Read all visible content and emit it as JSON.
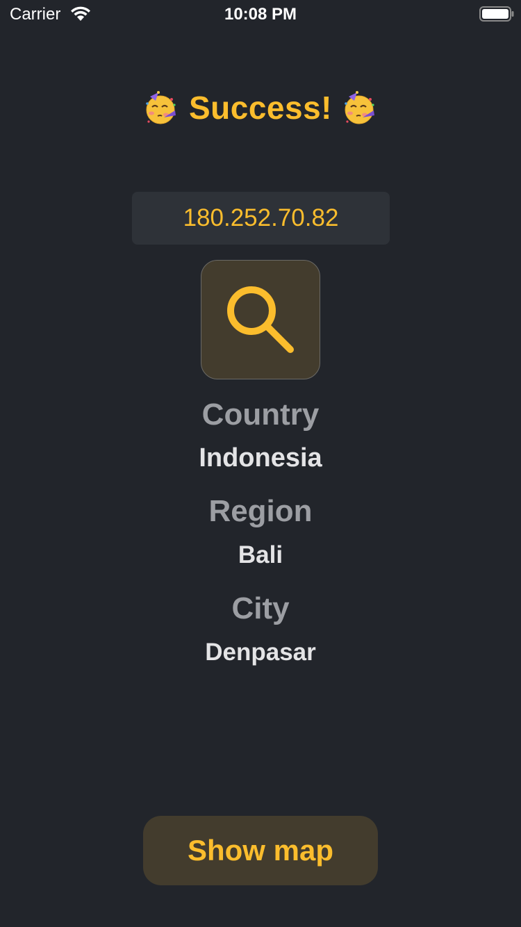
{
  "status_bar": {
    "carrier": "Carrier",
    "time": "10:08 PM"
  },
  "title": {
    "text": "Success!",
    "emoji_icon": "partying-face-icon"
  },
  "ip_field": {
    "value": "180.252.70.82"
  },
  "search_button": {
    "icon": "magnifying-glass-icon"
  },
  "info": {
    "country_label": "Country",
    "country_value": "Indonesia",
    "region_label": "Region",
    "region_value": "Bali",
    "city_label": "City",
    "city_value": "Denpasar"
  },
  "show_map": {
    "label": "Show map"
  },
  "colors": {
    "background": "#22252b",
    "accent": "#fbbd2d",
    "button_bg": "#433c2d",
    "field_bg": "#2e3238",
    "label": "#9c9ea3",
    "value": "#e4e4e6"
  }
}
